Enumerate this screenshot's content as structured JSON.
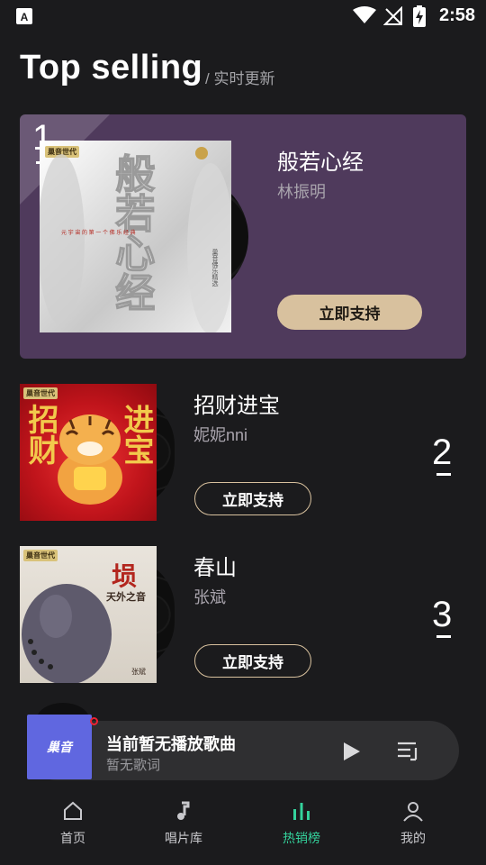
{
  "status_bar": {
    "time": "2:58"
  },
  "header": {
    "title": "Top selling",
    "subtitle": "/ 实时更新"
  },
  "featured": {
    "rank": "1",
    "title": "般若心经",
    "artist": "林振明",
    "support_label": "立即支持",
    "cover": {
      "badge": "巢音世代",
      "title": "般若心经",
      "slogan": "元 宇 宙 的 第 一 个 佛 乐 经 典",
      "side_text": "巢音佛乐精选"
    }
  },
  "list": [
    {
      "rank": "2",
      "title": "招财进宝",
      "artist": "妮妮nni",
      "support_label": "立即支持",
      "cover": {
        "badge": "巢音世代",
        "left_text": "招财",
        "right_text": "进宝"
      }
    },
    {
      "rank": "3",
      "title": "春山",
      "artist": "张斌",
      "support_label": "立即支持",
      "cover": {
        "badge": "巢音世代",
        "big_char": "埙",
        "caption": "天外之音",
        "author": "张斌"
      }
    }
  ],
  "player": {
    "cover_label": "巢音",
    "title": "当前暂无播放歌曲",
    "subtitle": "暂无歌词"
  },
  "nav": [
    {
      "label": "首页",
      "icon": "home-icon"
    },
    {
      "label": "唱片库",
      "icon": "music-note-icon"
    },
    {
      "label": "热销榜",
      "icon": "bar-chart-icon",
      "active": true
    },
    {
      "label": "我的",
      "icon": "person-icon"
    }
  ],
  "colors": {
    "background": "#1b1b1d",
    "featured_bg": "#4f3a5c",
    "accent_gold": "#d8c19e",
    "active_nav": "#34d29c",
    "player_cover": "#6067e0"
  }
}
